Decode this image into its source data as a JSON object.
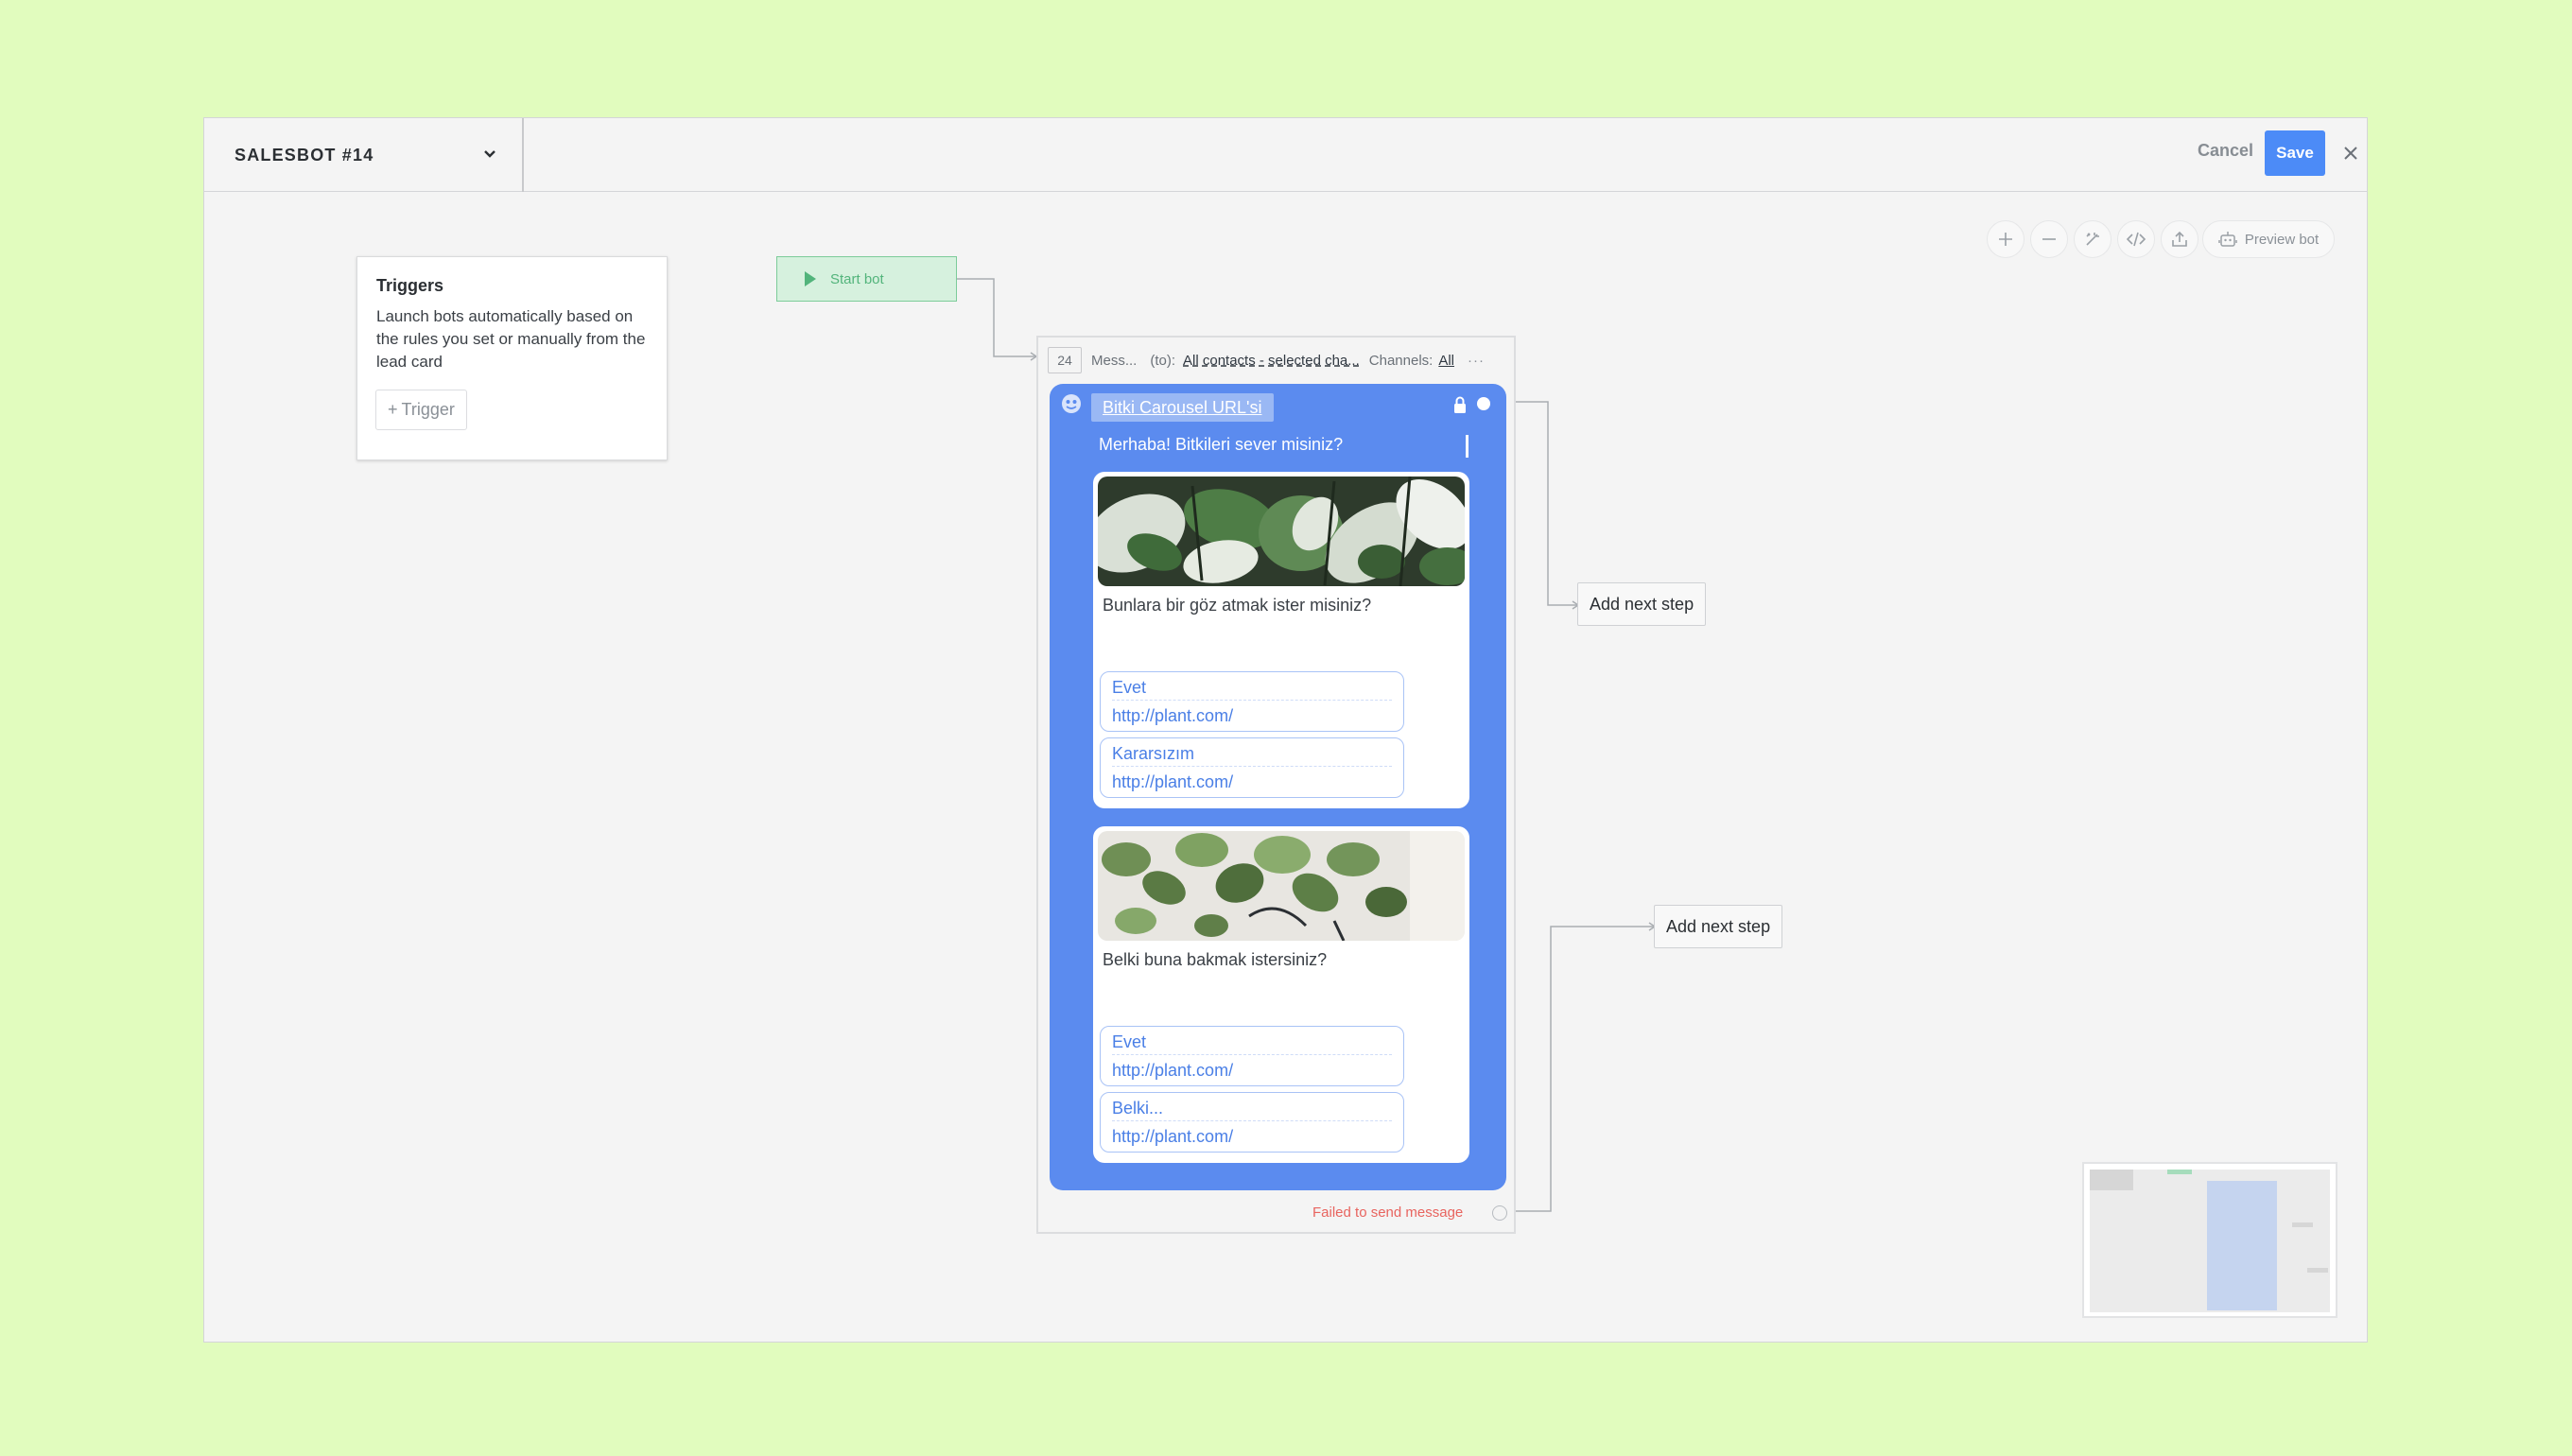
{
  "header": {
    "bot_name": "SALESBOT #14",
    "cancel_label": "Cancel",
    "save_label": "Save"
  },
  "toolbar": {
    "preview_label": "Preview bot"
  },
  "triggers": {
    "title": "Triggers",
    "description": "Launch bots automatically based on the rules you set or manually from the lead card",
    "add_label": "Trigger"
  },
  "start": {
    "label": "Start bot"
  },
  "message_step": {
    "number": "24",
    "type": "Mess...",
    "to_label": "(to):",
    "recipients": "All contacts - selected cha...",
    "channels_label": "Channels:",
    "channels_value": "All",
    "menu": "···",
    "name": "Bitki Carousel URL'si",
    "text": "Merhaba! Bitkileri sever misiniz?",
    "fail_label": "Failed to send message",
    "cards": [
      {
        "text": "Bunlara bir göz atmak ister misiniz?",
        "buttons": [
          {
            "label": "Evet",
            "url": "http://plant.com/"
          },
          {
            "label": "Kararsızım",
            "url": "http://plant.com/"
          }
        ]
      },
      {
        "text": "Belki buna bakmak istersiniz?",
        "buttons": [
          {
            "label": "Evet",
            "url": "http://plant.com/"
          },
          {
            "label": "Belki...",
            "url": "http://plant.com/"
          }
        ]
      }
    ]
  },
  "next_steps": {
    "first": "Add next step",
    "second": "Add next step"
  },
  "colors": {
    "background": "#e1fcbe",
    "accent": "#4c8bf7",
    "bubble": "#5b8bef",
    "start_green": "#52b47b",
    "error": "#e8645f"
  }
}
